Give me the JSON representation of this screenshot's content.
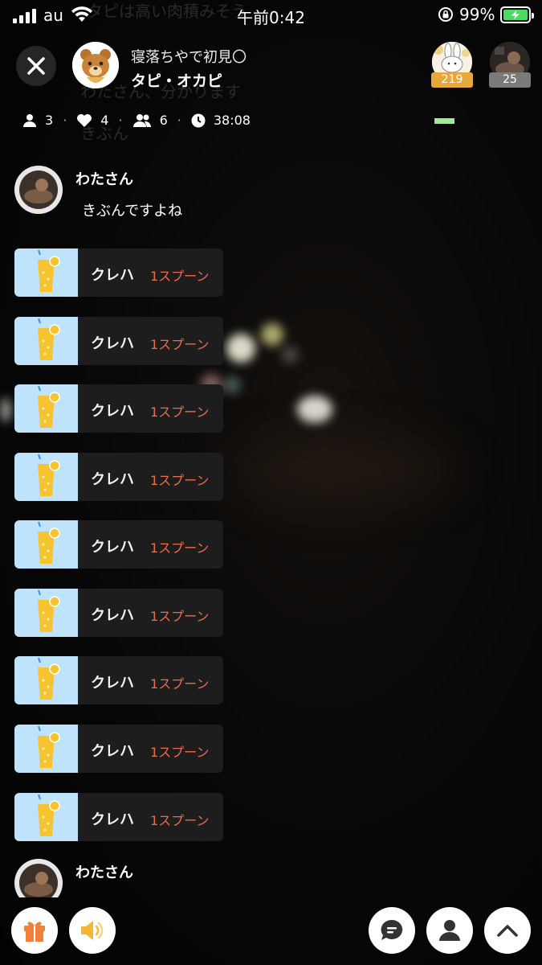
{
  "status_bar": {
    "carrier": "au",
    "time": "午前0:42",
    "battery": "99%"
  },
  "header": {
    "live_title": "寝落ちやで初見〇",
    "host_name": "タピ・オカピ",
    "top_users": [
      {
        "badge": "219",
        "badge_color": "#e8a73a"
      },
      {
        "badge": "25",
        "badge_color": "#7a7a7a"
      }
    ]
  },
  "stats": {
    "listeners": "3",
    "likes": "4",
    "members": "6",
    "duration": "38:08"
  },
  "chat": {
    "ghost_lines": [
      "タピは高い肉積みそう",
      "わたさん、分かります",
      "きぶん"
    ],
    "comments": [
      {
        "user": "わたさん",
        "text": "きぶんですよね"
      },
      {
        "user": "わたさん",
        "text": ""
      }
    ],
    "gifts": [
      {
        "sender": "クレハ",
        "amount": "1スプーン"
      },
      {
        "sender": "クレハ",
        "amount": "1スプーン"
      },
      {
        "sender": "クレハ",
        "amount": "1スプーン"
      },
      {
        "sender": "クレハ",
        "amount": "1スプーン"
      },
      {
        "sender": "クレハ",
        "amount": "1スプーン"
      },
      {
        "sender": "クレハ",
        "amount": "1スプーン"
      },
      {
        "sender": "クレハ",
        "amount": "1スプーン"
      },
      {
        "sender": "クレハ",
        "amount": "1スプーン"
      },
      {
        "sender": "クレハ",
        "amount": "1スプーン"
      }
    ]
  },
  "bottom_bar": {
    "left": [
      "gift-icon",
      "speaker-icon"
    ],
    "right": [
      "chat-bubble-icon",
      "profile-icon",
      "chevron-up-icon"
    ]
  },
  "colors": {
    "accent_amount": "#ef6b4c",
    "gift_orange": "#f0803c",
    "speaker_yellow": "#f5b731",
    "battery_green": "#4cd964"
  }
}
